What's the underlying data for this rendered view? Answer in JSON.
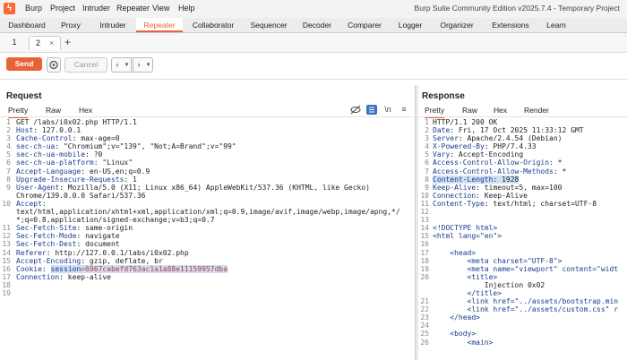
{
  "app": {
    "menu": [
      "Burp",
      "Project",
      "Intruder",
      "Repeater",
      "View",
      "Help"
    ],
    "window_title": "Burp Suite Community Edition v2025.7.4 - Temporary Project"
  },
  "main_tabs": [
    "Dashboard",
    "Proxy",
    "Intruder",
    "Repeater",
    "Collaborator",
    "Sequencer",
    "Decoder",
    "Comparer",
    "Logger",
    "Organizer",
    "Extensions",
    "Learn"
  ],
  "active_main_tab": "Repeater",
  "sub_tabs": [
    {
      "label": "1"
    },
    {
      "label": "2"
    }
  ],
  "sub_tab_close": "×",
  "sub_tab_add": "+",
  "toolbar": {
    "send_label": "Send",
    "cancel_label": "Cancel",
    "prev": "‹",
    "prev_menu": "▾",
    "next": "›",
    "next_menu": "▾"
  },
  "request": {
    "title": "Request",
    "tabs": [
      "Pretty",
      "Raw",
      "Hex"
    ],
    "icon_newline": "\\n",
    "icon_menu": "≡",
    "lines": [
      {
        "n": "1",
        "text": "GET /labs/i0x02.php HTTP/1.1"
      },
      {
        "n": "2",
        "key": "Host",
        "text": ": 127.0.0.1"
      },
      {
        "n": "3",
        "key": "Cache-Control",
        "text": ": max-age=0"
      },
      {
        "n": "4",
        "key": "sec-ch-ua",
        "text": ": \"Chromium\";v=\"139\", \"Not;A=Brand\";v=\"99\""
      },
      {
        "n": "5",
        "key": "sec-ch-ua-mobile",
        "text": ": ?0"
      },
      {
        "n": "6",
        "key": "sec-ch-ua-platform",
        "text": ": \"Linux\""
      },
      {
        "n": "7",
        "key": "Accept-Language",
        "text": ": en-US,en;q=0.9"
      },
      {
        "n": "8",
        "key": "Upgrade-Insecure-Requests",
        "text": ": 1"
      },
      {
        "n": "9",
        "key": "User-Agent",
        "text": ": Mozilla/5.0 (X11; Linux x86_64) AppleWebKit/537.36 (KHTML, like Gecko)"
      },
      {
        "n": "",
        "text": "Chrome/139.0.0.0 Safari/537.36"
      },
      {
        "n": "10",
        "key": "Accept",
        "text": ":"
      },
      {
        "n": "",
        "text": "text/html,application/xhtml+xml,application/xml;q=0.9,image/avif,image/webp,image/apng,*/"
      },
      {
        "n": "",
        "text": "*;q=0.8,application/signed-exchange;v=b3;q=0.7"
      },
      {
        "n": "11",
        "key": "Sec-Fetch-Site",
        "text": ": same-origin"
      },
      {
        "n": "12",
        "key": "Sec-Fetch-Mode",
        "text": ": navigate"
      },
      {
        "n": "13",
        "key": "Sec-Fetch-Dest",
        "text": ": document"
      },
      {
        "n": "14",
        "key": "Referer",
        "text": ": http://127.0.0.1/labs/i0x02.php"
      },
      {
        "n": "15",
        "key": "Accept-Encoding",
        "text": ": gzip, deflate, br"
      },
      {
        "n": "16",
        "key": "Cookie",
        "text": ": ",
        "cookie_key": "session",
        "cookie_val": "=6967cabefd763ac1a1a88e11159957dba"
      },
      {
        "n": "17",
        "key": "Connection",
        "text": ": keep-alive"
      },
      {
        "n": "18",
        "text": ""
      },
      {
        "n": "19",
        "text": ""
      }
    ]
  },
  "response": {
    "title": "Response",
    "tabs": [
      "Pretty",
      "Raw",
      "Hex",
      "Render"
    ],
    "lines": [
      {
        "n": "1",
        "text": "HTTP/1.1 200 OK"
      },
      {
        "n": "2",
        "key": "Date",
        "text": ": Fri, 17 Oct 2025 11:33:12 GMT"
      },
      {
        "n": "3",
        "key": "Server",
        "text": ": Apache/2.4.54 (Debian)"
      },
      {
        "n": "4",
        "key": "X-Powered-By",
        "text": ": PHP/7.4.33"
      },
      {
        "n": "5",
        "key": "Vary",
        "text": ": Accept-Encoding"
      },
      {
        "n": "6",
        "key": "Access-Control-Allow-Origin",
        "text": ": *"
      },
      {
        "n": "7",
        "key": "Access-Control-Allow-Methods",
        "text": ": *"
      },
      {
        "n": "8",
        "key": "Content-Length",
        "text": ": 1928",
        "sel": true
      },
      {
        "n": "9",
        "key": "Keep-Alive",
        "text": ": timeout=5, max=100"
      },
      {
        "n": "10",
        "key": "Connection",
        "text": ": Keep-Alive"
      },
      {
        "n": "11",
        "key": "Content-Type",
        "text": ": text/html; charset=UTF-8"
      },
      {
        "n": "12",
        "text": ""
      },
      {
        "n": "13",
        "text": ""
      },
      {
        "n": "14",
        "html": "<!DOCTYPE html>"
      },
      {
        "n": "15",
        "html": "<html lang=\"en\">"
      },
      {
        "n": "16",
        "text": ""
      },
      {
        "n": "17",
        "html": "    <head>"
      },
      {
        "n": "18",
        "html": "        <meta charset=\"UTF-8\">"
      },
      {
        "n": "19",
        "html": "        <meta name=\"viewport\" content=\"widt"
      },
      {
        "n": "20",
        "html": "        <title>"
      },
      {
        "n": "",
        "text": "            Injection 0x02"
      },
      {
        "n": "",
        "html": "        </title>"
      },
      {
        "n": "21",
        "html": "        <link href=\"../assets/bootstrap.min"
      },
      {
        "n": "22",
        "html": "        <link href=\"../assets/custom.css\" r"
      },
      {
        "n": "23",
        "html": "    </head>"
      },
      {
        "n": "24",
        "text": ""
      },
      {
        "n": "25",
        "html": "    <body>"
      },
      {
        "n": "26",
        "html": "        <main>"
      }
    ]
  }
}
